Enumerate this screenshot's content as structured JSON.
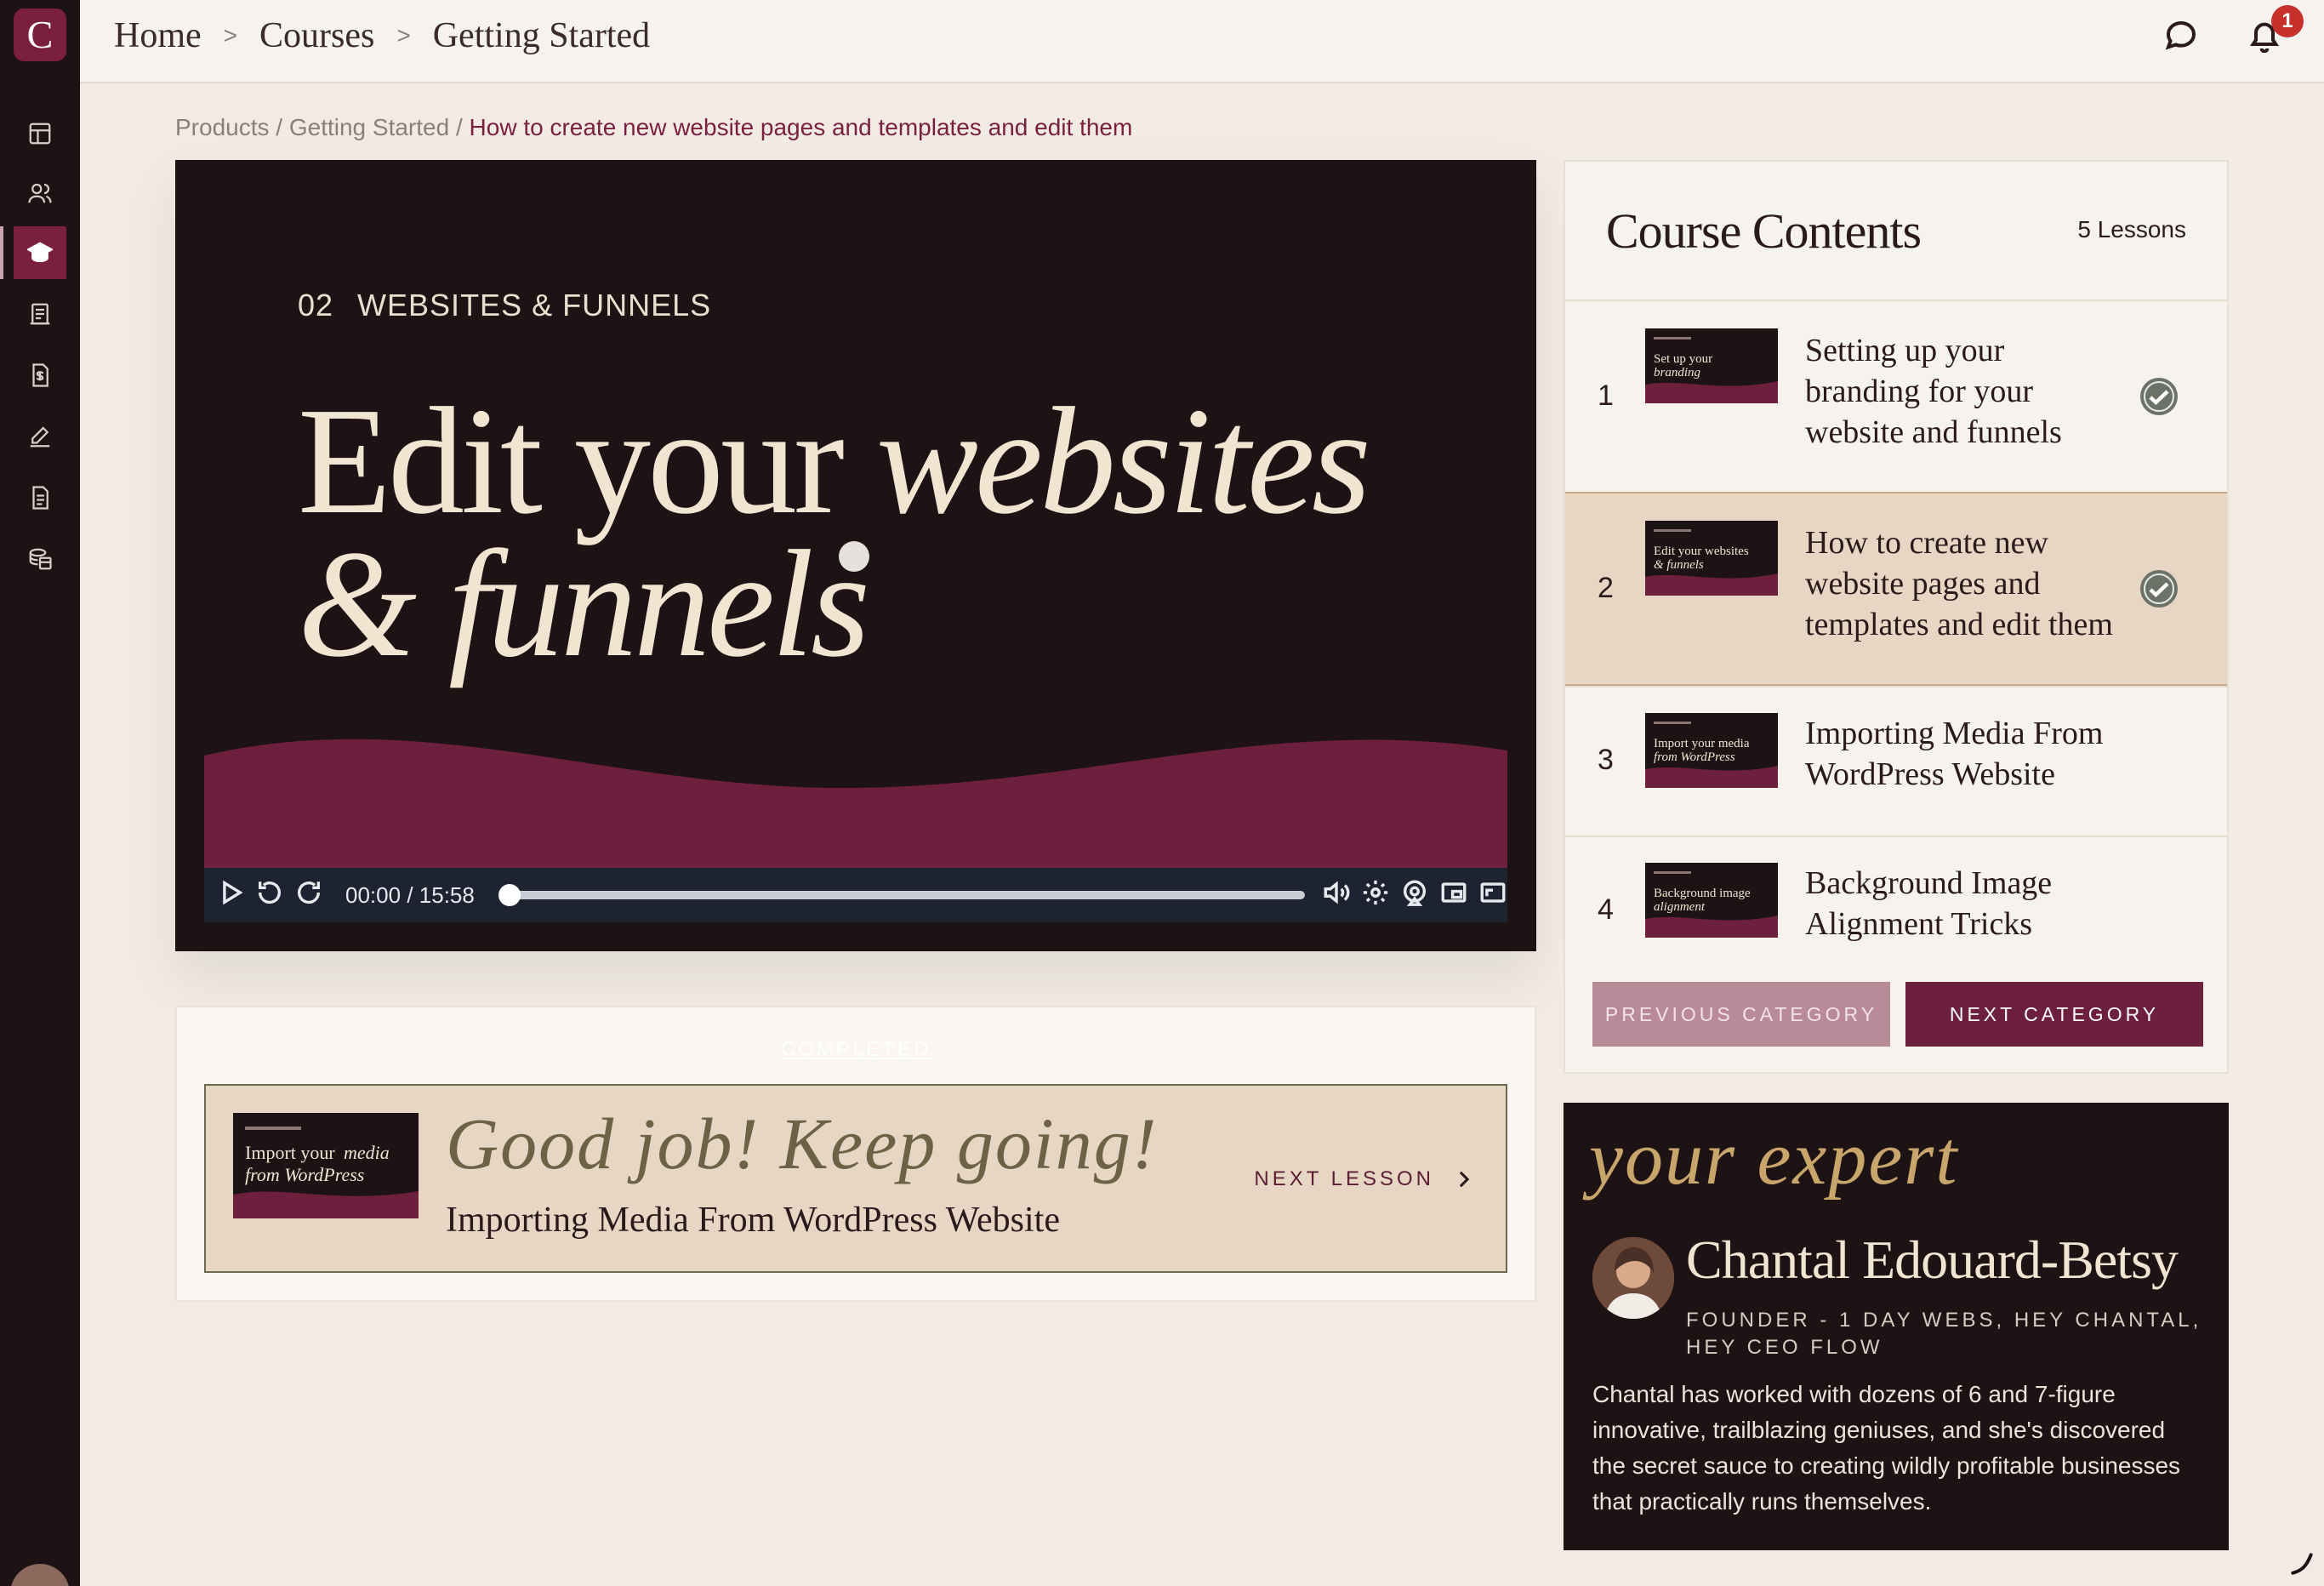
{
  "app": {
    "logo_letter": "C"
  },
  "sidebar": {
    "items": [
      {
        "name": "dashboard-icon"
      },
      {
        "name": "contacts-icon"
      },
      {
        "name": "courses-icon",
        "active": true
      },
      {
        "name": "products-icon"
      },
      {
        "name": "invoices-icon"
      },
      {
        "name": "signatures-icon"
      },
      {
        "name": "documents-icon"
      },
      {
        "name": "payments-icon"
      }
    ]
  },
  "topbar": {
    "crumbs": [
      "Home",
      "Courses",
      "Getting Started"
    ],
    "separator": ">",
    "notification_count": "1"
  },
  "path": {
    "part1": "Products",
    "part2": "Getting Started",
    "current": "How to create new website pages and templates and edit them",
    "sep": " / "
  },
  "video": {
    "section_number": "02",
    "section_name": "WEBSITES & FUNNELS",
    "title_line1_plain": "Edit your ",
    "title_line1_italic": "websites",
    "title_line2_italic": "& funnels",
    "current_time": "00:00",
    "time_sep": "/",
    "duration": "15:58",
    "progress": 0
  },
  "completion": {
    "completed_label": "COMPLETED",
    "message": "Good job! Keep going!",
    "next_title": "Importing Media From WordPress Website",
    "next_label": "NEXT LESSON",
    "thumb_line1": "Import your",
    "thumb_line1_italic": "media",
    "thumb_line2_italic": "from WordPress"
  },
  "contents": {
    "title": "Course Contents",
    "count": "5 Lessons",
    "lessons": [
      {
        "num": "1",
        "title": "Setting up your branding for your website and funnels",
        "thumb_a": "Set up your",
        "thumb_b": "branding",
        "done": true
      },
      {
        "num": "2",
        "title": "How to create new website pages and templates and edit them",
        "thumb_a": "Edit your websites",
        "thumb_b": "& funnels",
        "done": true,
        "active": true
      },
      {
        "num": "3",
        "title": "Importing Media From WordPress Website",
        "thumb_a": "Import your media",
        "thumb_b": "from WordPress",
        "done": false
      },
      {
        "num": "4",
        "title": "Background Image Alignment Tricks",
        "thumb_a": "Background image",
        "thumb_b": "alignment",
        "done": false
      }
    ],
    "prev_label": "PREVIOUS CATEGORY",
    "next_label": "NEXT CATEGORY"
  },
  "expert": {
    "script_heading": "your expert",
    "name": "Chantal Edouard-Betsy",
    "role": "FOUNDER - 1 DAY WEBS, HEY CHANTAL, HEY CEO FLOW",
    "bio": "Chantal has worked with dozens of 6 and 7-figure innovative, trailblazing geniuses, and she's discovered the secret sauce to creating wildly profitable businesses that practically runs themselves."
  },
  "colors": {
    "brand": "#7a1f40",
    "dark": "#1e1314",
    "beige": "#e6d6c3",
    "page": "#f1ebe3",
    "gold": "#c8a56a"
  }
}
